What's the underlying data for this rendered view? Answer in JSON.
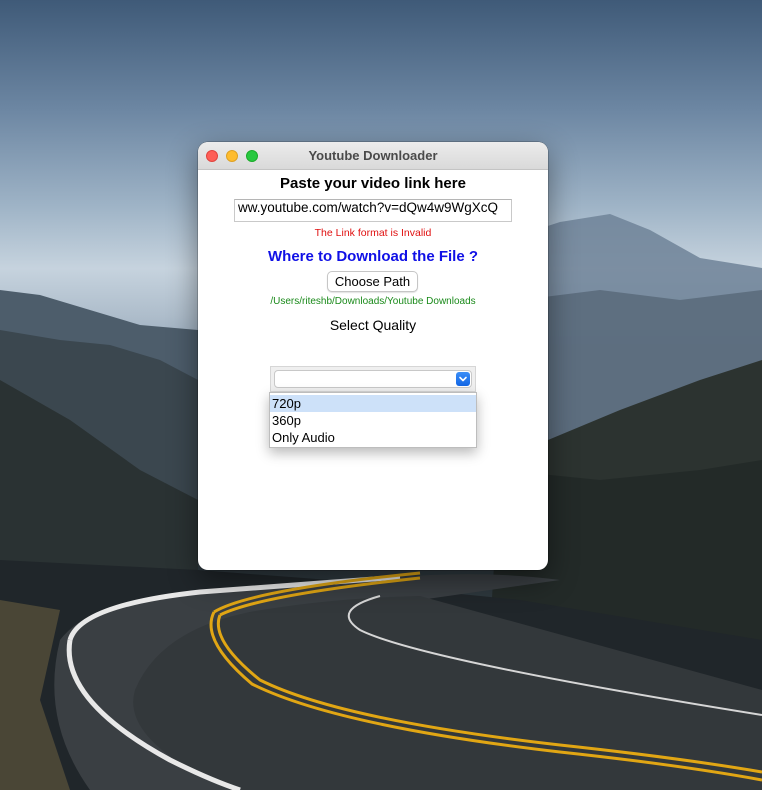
{
  "window": {
    "title": "Youtube Downloader"
  },
  "form": {
    "paste_heading": "Paste your video link here",
    "link_value": "ww.youtube.com/watch?v=dQw4w9WgXcQ",
    "error_message": "The Link format is Invalid",
    "download_heading": "Where to Download the File ?",
    "choose_path_label": "Choose Path",
    "selected_path": "/Users/riteshb/Downloads/Youtube Downloads",
    "quality_label": "Select Quality",
    "quality_selected": ""
  },
  "quality_options": [
    {
      "label": "720p",
      "highlighted": true
    },
    {
      "label": "360p",
      "highlighted": false
    },
    {
      "label": "Only Audio",
      "highlighted": false
    }
  ],
  "colors": {
    "error": "#e01010",
    "download_heading": "#1010e6",
    "path": "#1a8a1a",
    "highlight": "#cde1f9",
    "close": "#fe5f57",
    "minimize": "#febc2e",
    "maximize": "#28c840"
  },
  "icons": {
    "dropdown_arrow": "chevron-down-icon"
  }
}
